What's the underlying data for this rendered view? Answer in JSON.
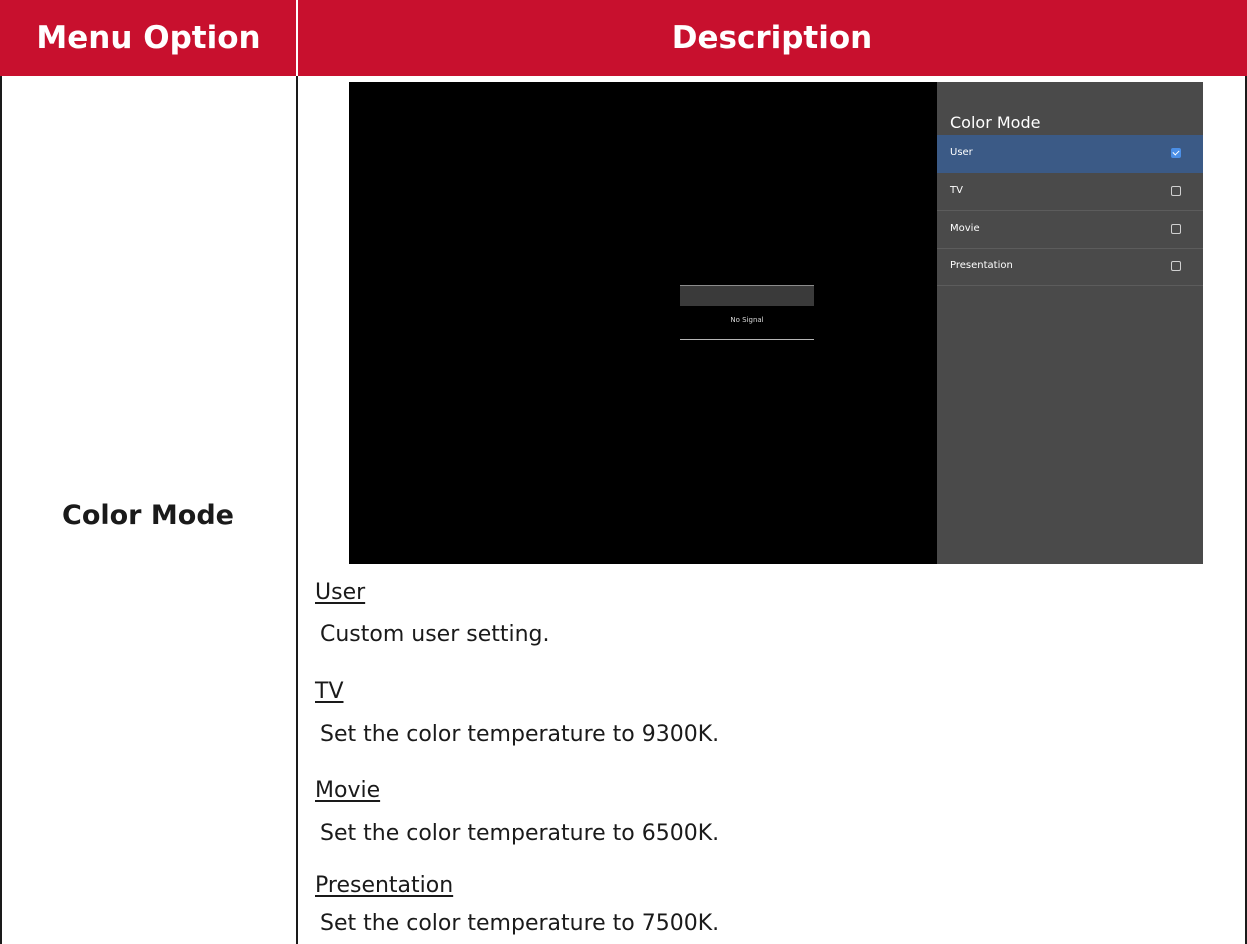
{
  "table": {
    "header": {
      "menu_option": "Menu Option",
      "description": "Description"
    },
    "row": {
      "menu_option": "Color Mode"
    }
  },
  "osd": {
    "no_signal": "No Signal",
    "panel_title": "Color Mode",
    "items": [
      {
        "label": "User",
        "checked": true
      },
      {
        "label": "TV",
        "checked": false
      },
      {
        "label": "Movie",
        "checked": false
      },
      {
        "label": "Presentation",
        "checked": false
      }
    ],
    "colors": {
      "selected_bg": "#3b5a86",
      "check_accent": "#4b8fe6",
      "panel_bg": "#4a4a4a"
    }
  },
  "descriptions": [
    {
      "term": "User",
      "text": "Custom user setting."
    },
    {
      "term": "TV",
      "text": "Set the color temperature to 9300K."
    },
    {
      "term": "Movie",
      "text": "Set the color temperature to 6500K."
    },
    {
      "term": "Presentation",
      "text": "Set the color temperature to 7500K."
    }
  ],
  "colors": {
    "header_bg": "#c8102e",
    "header_text": "#ffffff"
  }
}
